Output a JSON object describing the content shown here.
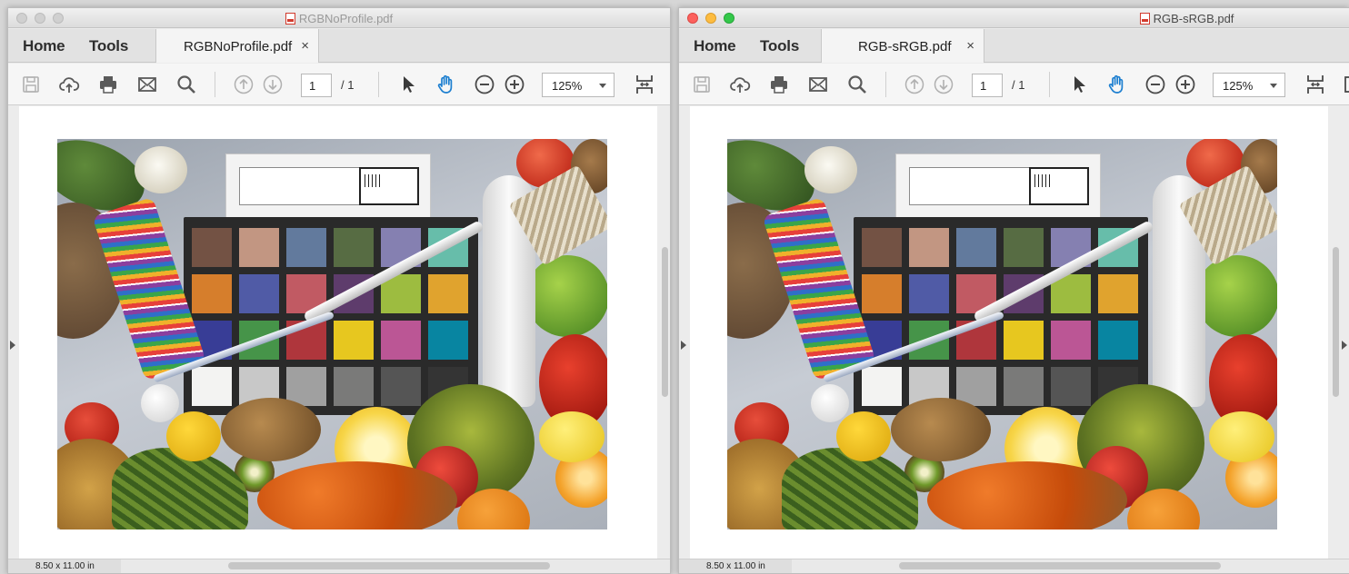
{
  "windows": [
    {
      "title": "RGBNoProfile.pdf",
      "nav": {
        "home": "Home",
        "tools": "Tools"
      },
      "tab": {
        "label": "RGBNoProfile.pdf",
        "close": "×"
      },
      "toolbar": {
        "page_current": "1",
        "page_total": "/ 1",
        "zoom": "125%"
      },
      "status": {
        "page_size": "8.50 x 11.00 in"
      }
    },
    {
      "title": "RGB-sRGB.pdf",
      "nav": {
        "home": "Home",
        "tools": "Tools"
      },
      "tab": {
        "label": "RGB-sRGB.pdf",
        "close": "×"
      },
      "toolbar": {
        "page_current": "1",
        "page_total": "/ 1",
        "zoom": "125%"
      },
      "status": {
        "page_size": "8.50 x 11.00 in"
      }
    }
  ],
  "icons": [
    "save-icon",
    "upload-cloud-icon",
    "print-icon",
    "email-icon",
    "search-icon",
    "page-up-icon",
    "page-down-icon",
    "select-pointer-icon",
    "hand-tool-icon",
    "zoom-out-icon",
    "zoom-in-icon",
    "fit-page-icon"
  ],
  "colors": {
    "accent_blue": "#1d7fd0",
    "icon_gray": "#5a5a5a",
    "disabled_gray": "#b0b0b0"
  },
  "checker_colors": [
    "#735244",
    "#c29682",
    "#627a9d",
    "#576c43",
    "#8580b1",
    "#67bdaa",
    "#d67e2c",
    "#505ba6",
    "#c15a63",
    "#5e3c6c",
    "#9dbc40",
    "#e0a32e",
    "#383d96",
    "#469449",
    "#af363c",
    "#e7c71f",
    "#bb5695",
    "#0885a1",
    "#f3f3f2",
    "#c8c8c8",
    "#a0a0a0",
    "#7a7a79",
    "#555555",
    "#343434"
  ]
}
